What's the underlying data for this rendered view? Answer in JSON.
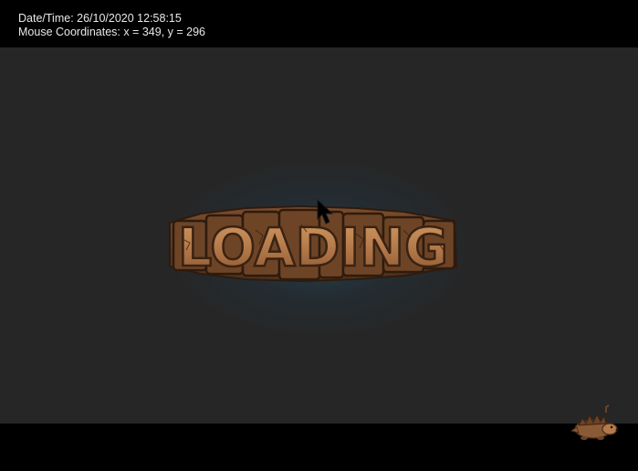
{
  "overlay": {
    "datetime_line": "Date/Time: 26/10/2020 12:58:15",
    "mouse_line": "Mouse Coordinates: x = 349, y = 296"
  },
  "loading": {
    "title": "LOADING"
  },
  "colors": {
    "background": "#262626",
    "bars": "#000000",
    "overlay_text": "#e8e8e8",
    "stone_face": "#b57a4a",
    "stone_dark": "#5c3a22",
    "glow": "#285a78"
  },
  "icons": {
    "cursor": "arrow-cursor-icon",
    "mascot": "hedgehog-mascot-icon"
  }
}
